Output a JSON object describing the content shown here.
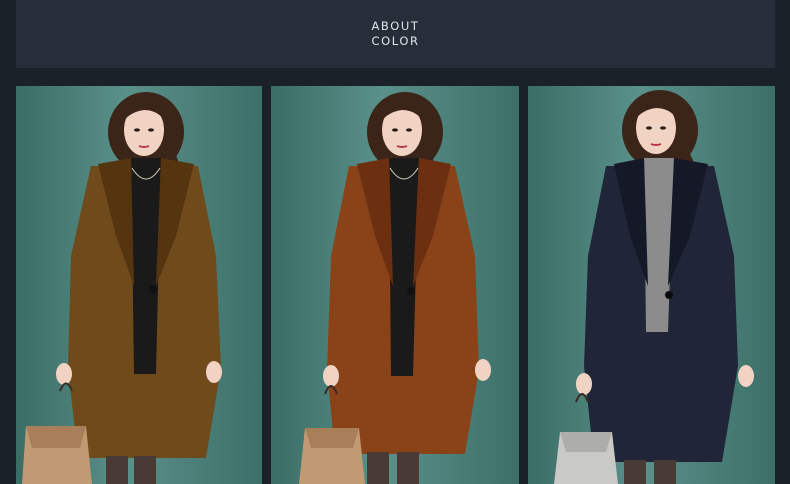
{
  "header": {
    "line1": "ABOUT",
    "line2": "COLOR"
  },
  "panels": [
    {
      "coat_color": "#6f4a1b",
      "coat_shade": "#553510",
      "inner_color": "#1a1a1a",
      "bag_color": "#c09a72"
    },
    {
      "coat_color": "#8a4318",
      "coat_shade": "#6c3010",
      "inner_color": "#1a1a1a",
      "bag_color": "#c09a72"
    },
    {
      "coat_color": "#202538",
      "coat_shade": "#151827",
      "inner_color": "#8c8c8c",
      "bag_color": "#c9c9c6"
    }
  ],
  "colors": {
    "page_bg": "#1b2129",
    "header_bg": "#262e39",
    "header_text": "#dfe4ea",
    "backdrop": "#4f8780",
    "hair": "#3b2418",
    "skin": "#f1d3c4"
  }
}
